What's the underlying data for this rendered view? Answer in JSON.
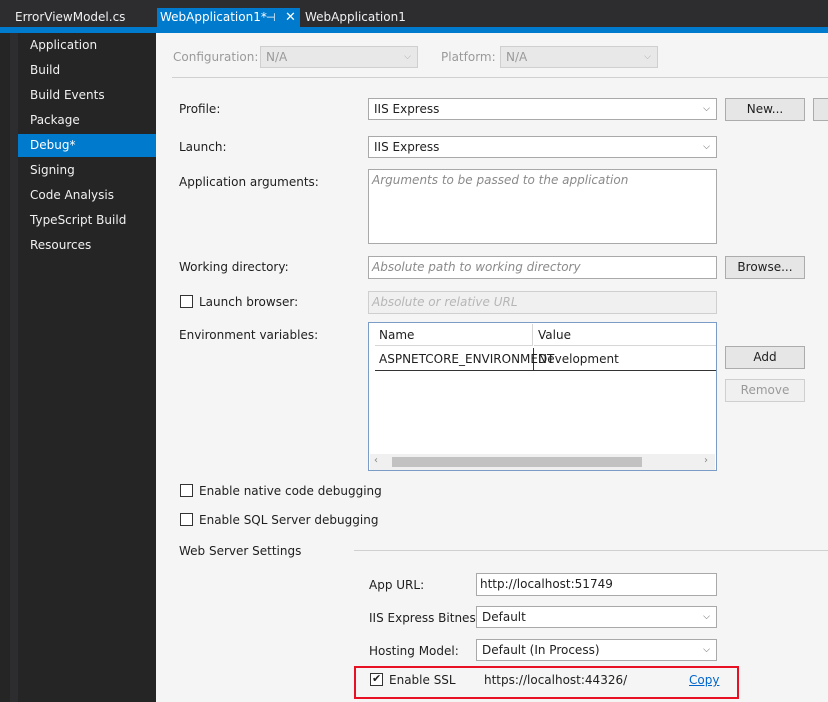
{
  "tabs": [
    {
      "label": "ErrorViewModel.cs",
      "active": false
    },
    {
      "label": "WebApplication1*",
      "active": true,
      "pin_icon": "pin-icon",
      "close_icon": "close-icon"
    },
    {
      "label": "WebApplication1",
      "active": false
    }
  ],
  "sidebar": {
    "items": [
      {
        "label": "Application"
      },
      {
        "label": "Build"
      },
      {
        "label": "Build Events"
      },
      {
        "label": "Package"
      },
      {
        "label": "Debug*",
        "active": true
      },
      {
        "label": "Signing"
      },
      {
        "label": "Code Analysis"
      },
      {
        "label": "TypeScript Build"
      },
      {
        "label": "Resources"
      }
    ]
  },
  "config": {
    "configuration_label": "Configuration:",
    "configuration_value": "N/A",
    "platform_label": "Platform:",
    "platform_value": "N/A"
  },
  "profile": {
    "label": "Profile:",
    "value": "IIS Express",
    "new_button": "New...",
    "delete_button": ""
  },
  "launch": {
    "label": "Launch:",
    "value": "IIS Express"
  },
  "app_args": {
    "label": "Application arguments:",
    "placeholder": "Arguments to be passed to the application"
  },
  "working_dir": {
    "label": "Working directory:",
    "placeholder": "Absolute path to working directory",
    "browse_button": "Browse..."
  },
  "launch_browser": {
    "label": "Launch browser:",
    "checked": false,
    "placeholder": "Absolute or relative URL"
  },
  "env": {
    "label": "Environment variables:",
    "columns": [
      "Name",
      "Value"
    ],
    "rows": [
      {
        "name": "ASPNETCORE_ENVIRONMENT",
        "value": "Development"
      }
    ],
    "add_button": "Add",
    "remove_button": "Remove"
  },
  "native_debug": {
    "label": "Enable native code debugging",
    "checked": false
  },
  "sql_debug": {
    "label": "Enable SQL Server debugging",
    "checked": false
  },
  "web_server": {
    "section_label": "Web Server Settings",
    "app_url_label": "App URL:",
    "app_url_value": "http://localhost:51749",
    "bitness_label": "IIS Express Bitness:",
    "bitness_value": "Default",
    "hosting_label": "Hosting Model:",
    "hosting_value": "Default (In Process)",
    "ssl_label": "Enable SSL",
    "ssl_checked": true,
    "ssl_url": "https://localhost:44326/",
    "copy_link": "Copy",
    "highlight_color": "#e81123"
  },
  "colors": {
    "accent": "#007acc",
    "sidebar_bg": "#252526",
    "content_bg": "#f5f5f5"
  }
}
